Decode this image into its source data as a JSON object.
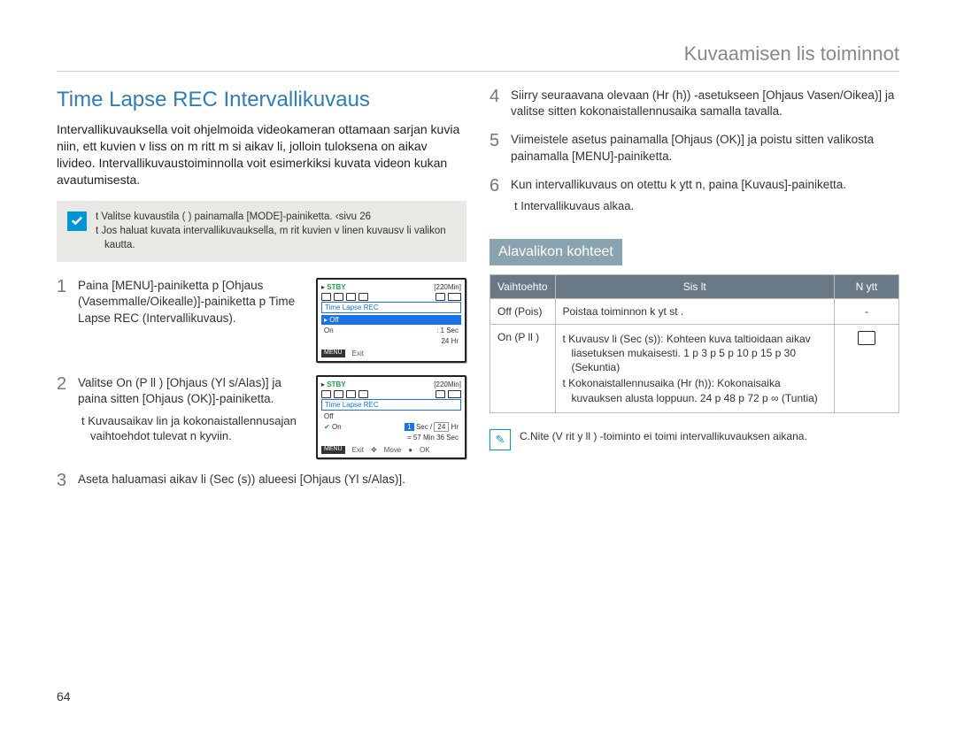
{
  "header": "Kuvaamisen lis toiminnot",
  "title": "Time Lapse REC Intervallikuvaus",
  "intro": "Intervallikuvauksella voit ohjelmoida videokameran ottamaan sarjan kuvia niin, ett  kuvien v liss  on m  ritt m si aikav li, jolloin tuloksena on aikav livideo. Intervallikuvaustoiminnolla voit esimerkiksi kuvata videon kukan avautumisesta.",
  "note": {
    "line1": "t  Valitse kuvaustila (    ) painamalla [MODE]-painiketta.  ‹sivu 26",
    "line2": "t  Jos haluat kuvata intervallikuvauksella, m  rit  kuvien v linen kuvausv li valikon kautta."
  },
  "steps_left": [
    {
      "num": "1",
      "text": "Paina [MENU]-painiketta p  [Ohjaus (Vasemmalle/Oikealle)]-painiketta p  Time Lapse REC (Intervallikuvaus)."
    },
    {
      "num": "2",
      "text": "Valitse On (P  ll ) [Ohjaus (Yl s/Alas)] ja paina sitten [Ohjaus (OK)]-painiketta.",
      "sub": "t  Kuvausaikav lin ja kokonaistallennusajan vaihtoehdot tulevat n kyviin."
    },
    {
      "num": "3",
      "text": "Aseta haluamasi aikav li (Sec (s)) alueesi [Ohjaus (Yl s/Alas)]."
    }
  ],
  "steps_right": [
    {
      "num": "4",
      "text": "Siirry seuraavana olevaan (Hr (h)) -asetukseen [Ohjaus Vasen/Oikea)] ja valitse sitten kokonaistallennusaika samalla tavalla."
    },
    {
      "num": "5",
      "text": "Viimeistele asetus painamalla [Ohjaus (OK)] ja poistu sitten valikosta painamalla [MENU]-painiketta."
    },
    {
      "num": "6",
      "text": "Kun intervallikuvaus on otettu k ytt  n, paina [Kuvaus]-painiketta.",
      "sub": "t  Intervallikuvaus alkaa."
    }
  ],
  "camera1": {
    "stby": "STBY",
    "time": "220Min",
    "title": "Time Lapse REC",
    "off": "Off",
    "on": "On",
    "sec": ": 1 Sec",
    "hr": "24 Hr",
    "exit": "Exit"
  },
  "camera2": {
    "stby": "STBY",
    "time": "220Min",
    "title": "Time Lapse REC",
    "off": "Off",
    "on": "On",
    "secval": "1",
    "seclbl": "Sec /",
    "hrval": "24",
    "hrlbl": "Hr",
    "remain": "= 57 Min 36 Sec",
    "exit": "Exit",
    "move": "Move",
    "ok": "OK"
  },
  "subheading": "Alavalikon kohteet",
  "table": {
    "head": {
      "c1": "Vaihtoehto",
      "c2": "Sis lt",
      "c3": "N ytt"
    },
    "row1": {
      "c1": "Off (Pois)",
      "c2": "Poistaa toiminnon k yt st .",
      "c3": "-"
    },
    "row2": {
      "c1": "On (P  ll )",
      "b1": "t  Kuvausv li (Sec (s)): Kohteen kuva taltioidaan aikav liasetuksen mukaisesti. 1  p  3  p  5  p  10  p  15  p  30 (Sekuntia)",
      "b2": "t  Kokonaistallennusaika (Hr (h)): Kokonaisaika kuvauksen alusta loppuun. 24  p  48  p  72  p  ∞ (Tuntia)"
    }
  },
  "footnote": "C.Nite (V rit y ll ) -toiminto ei toimi intervallikuvauksen aikana.",
  "pagenum": "64"
}
